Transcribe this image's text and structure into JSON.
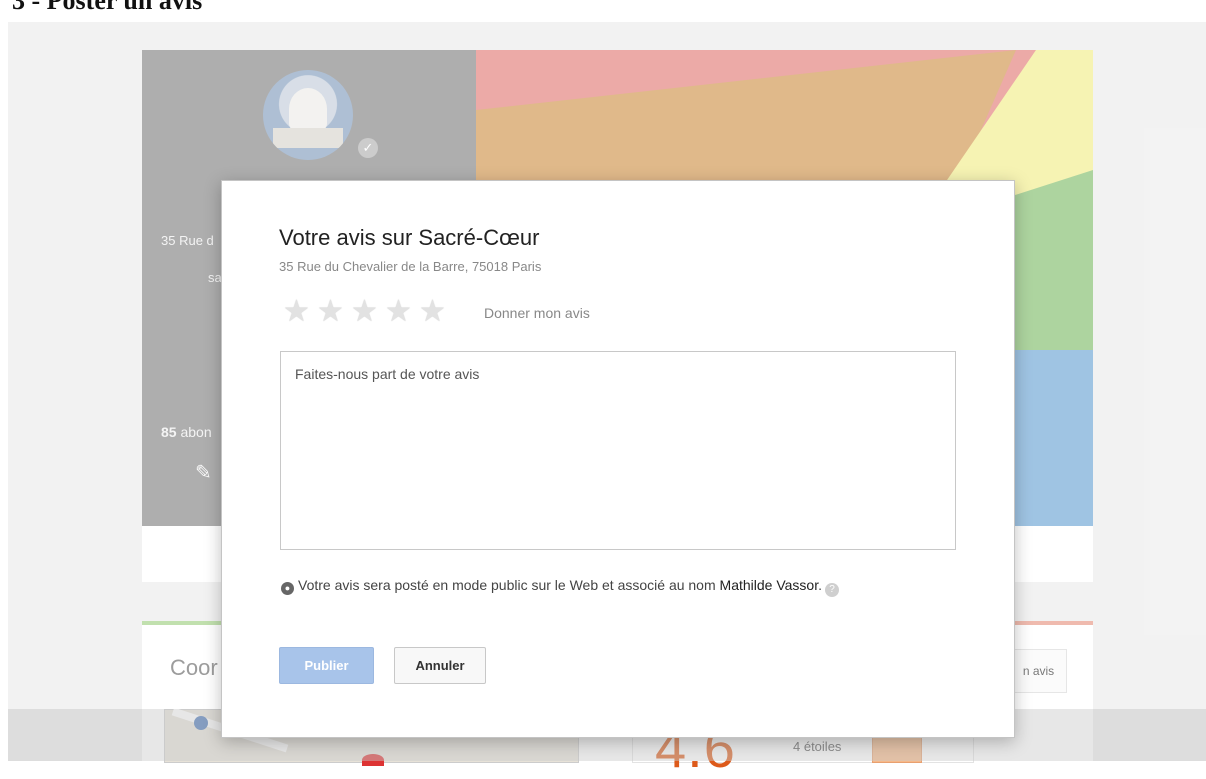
{
  "page": {
    "heading": "3 - Poster un avis"
  },
  "background": {
    "cover_address_line1": "35 Rue d",
    "cover_address_line2": "sa",
    "followers_count": "85",
    "followers_label": " abon",
    "coordinates_title": "Coor",
    "review_button_label": "n avis",
    "overall_rating": "4.6",
    "rating_row_label": "4 étoiles"
  },
  "dialog": {
    "title": "Votre avis sur Sacré-Cœur",
    "address": "35 Rue du Chevalier de la Barre, 75018 Paris",
    "star_count": 5,
    "rating_value": 0,
    "rating_prompt": "Donner mon avis",
    "review_placeholder": "Faites-nous part de votre avis",
    "review_value": "",
    "notice_text": "Votre avis sera posté en mode public sur le Web et associé au nom ",
    "notice_name": "Mathilde Vassor",
    "notice_end": ".",
    "publish_label": "Publier",
    "cancel_label": "Annuler"
  },
  "colors": {
    "publish_button": "#a8c4ea",
    "rating_accent": "#dd5a1a",
    "cover_gray": "#8f8f8f"
  },
  "icons": [
    "verified-icon",
    "pencil-icon",
    "star-icon",
    "globe-icon",
    "help-icon"
  ]
}
